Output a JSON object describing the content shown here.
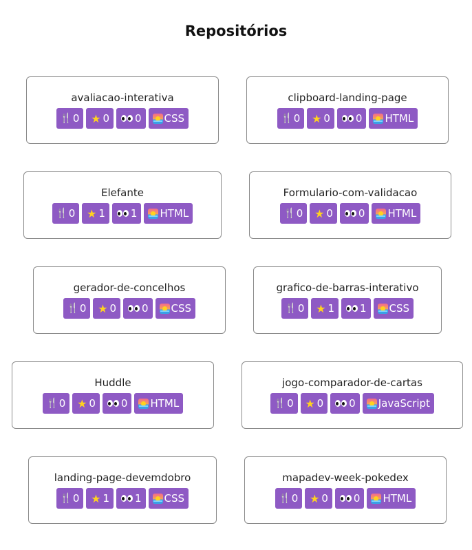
{
  "page": {
    "title": "Repositórios"
  },
  "repos": [
    {
      "name": "avaliacao-interativa",
      "forks": "0",
      "stars": "0",
      "watchers": "0",
      "language": "CSS"
    },
    {
      "name": "clipboard-landing-page",
      "forks": "0",
      "stars": "0",
      "watchers": "0",
      "language": "HTML"
    },
    {
      "name": "Elefante",
      "forks": "0",
      "stars": "1",
      "watchers": "1",
      "language": "HTML"
    },
    {
      "name": "Formulario-com-validacao",
      "forks": "0",
      "stars": "0",
      "watchers": "0",
      "language": "HTML"
    },
    {
      "name": "gerador-de-concelhos",
      "forks": "0",
      "stars": "0",
      "watchers": "0",
      "language": "CSS"
    },
    {
      "name": "grafico-de-barras-interativo",
      "forks": "0",
      "stars": "1",
      "watchers": "1",
      "language": "CSS"
    },
    {
      "name": "Huddle",
      "forks": "0",
      "stars": "0",
      "watchers": "0",
      "language": "HTML"
    },
    {
      "name": "jogo-comparador-de-cartas",
      "forks": "0",
      "stars": "0",
      "watchers": "0",
      "language": "JavaScript"
    },
    {
      "name": "landing-page-devemdobro",
      "forks": "0",
      "stars": "1",
      "watchers": "1",
      "language": "CSS"
    },
    {
      "name": "mapadev-week-pokedex",
      "forks": "0",
      "stars": "0",
      "watchers": "0",
      "language": "HTML"
    }
  ],
  "icons": {
    "fork": "fork-and-knife-icon",
    "star": "star-icon",
    "watchers": "eyes-icon",
    "language": "sunrise-icon"
  },
  "colors": {
    "badge": "#8e5ac4",
    "card_border": "#8a8a8a",
    "star": "#ffd21f"
  }
}
